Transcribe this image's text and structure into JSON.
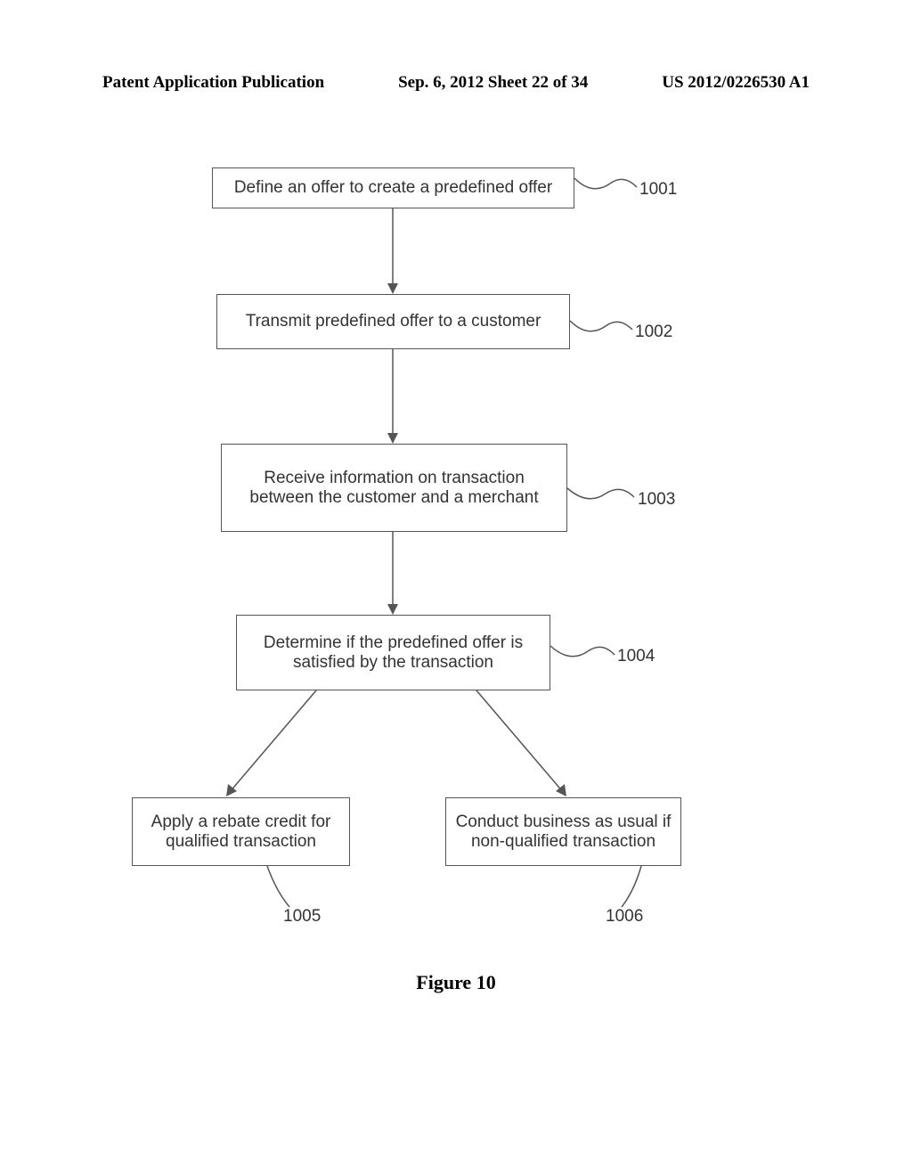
{
  "header": {
    "left": "Patent Application Publication",
    "center": "Sep. 6, 2012   Sheet 22 of 34",
    "right": "US 2012/0226530 A1"
  },
  "boxes": {
    "b1001": {
      "text": "Define an offer to create a predefined offer",
      "label": "1001"
    },
    "b1002": {
      "text": "Transmit predefined offer to a customer",
      "label": "1002"
    },
    "b1003": {
      "text": "Receive information on transaction between the customer and a merchant",
      "label": "1003"
    },
    "b1004": {
      "text": "Determine if the predefined offer is satisfied by the transaction",
      "label": "1004"
    },
    "b1005": {
      "text": "Apply a rebate credit for qualified transaction",
      "label": "1005"
    },
    "b1006": {
      "text": "Conduct business as usual if non-qualified transaction",
      "label": "1006"
    }
  },
  "caption": "Figure 10"
}
